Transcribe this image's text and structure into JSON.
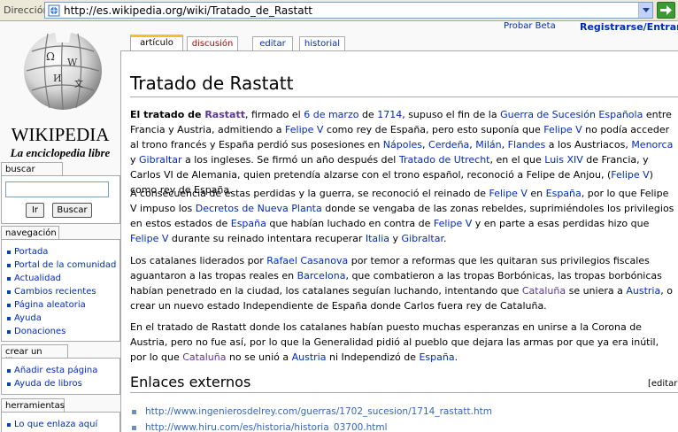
{
  "browser": {
    "address_label": "Dirección",
    "url": "http://es.wikipedia.org/wiki/Tratado_de_Rastatt"
  },
  "logo": {
    "wordmark": "WIKIPEDIA",
    "tagline": "La enciclopedia libre"
  },
  "sidebar": {
    "search": {
      "heading": "buscar",
      "go_label": "Ir",
      "search_label": "Buscar"
    },
    "navigation": {
      "heading": "navegación",
      "items": [
        "Portada",
        "Portal de la comunidad",
        "Actualidad",
        "Cambios recientes",
        "Página aleatoria",
        "Ayuda",
        "Donaciones"
      ]
    },
    "create_book": {
      "heading": "crear un libro",
      "items": [
        "Añadir esta página",
        "Ayuda de libros"
      ]
    },
    "tools": {
      "heading": "herramientas",
      "items": [
        "Lo que enlaza aquí"
      ]
    }
  },
  "top_links": {
    "beta": "Probar Beta",
    "login": "Registrarse/Entrar"
  },
  "tabs": {
    "article": "artículo",
    "discussion": "discusión",
    "edit": "editar",
    "history": "historial"
  },
  "article": {
    "title": "Tratado de Rastatt",
    "section_title": "Enlaces externos",
    "section_edit": "[editar]",
    "external_links": [
      "http://www.ingenierosdelrey.com/guerras/1702_sucesion/1714_rastatt.htm",
      "http://www.hiru.com/es/historia/historia_03700.html"
    ],
    "p1": {
      "b1": "El tratado de ",
      "b2": "Rastatt",
      "t1": ", firmado el ",
      "l1": "6 de marzo",
      "t2": " de ",
      "l2": "1714",
      "t3": ", supuso el fin de la ",
      "l3": "Guerra de Sucesión Española",
      "t4": " entre Francia y Austria, admitiendo a ",
      "l4": "Felipe V",
      "t5": " como rey de España, pero esto suponía que ",
      "l5": "Felipe V",
      "t6": " no podía acceder al trono francés y España perdió sus posesiones en ",
      "l6": "Nápoles",
      "t7": ", ",
      "l7": "Cerdeña",
      "t8": ", ",
      "l8": "Milán",
      "t9": ", ",
      "l9": "Flandes",
      "t10": " a los Austriacos, ",
      "l10": "Menorca",
      "t11": " y ",
      "l11": "Gibraltar",
      "t12": " a los ingleses. Se firmó un año después del ",
      "l12": "Tratado de Utrecht",
      "t13": ", en el que ",
      "l13": "Luis XIV",
      "t14": " de Francia, y Carlos VI de Alemania, quien pretendía alzarse con el trono español, reconoció a Felipe de Anjou, (",
      "l14": "Felipe V",
      "t15": ") como rey de España."
    },
    "p2": {
      "t1": "A consecuencia de estas perdidas y la guerra, se reconoció el reinado de ",
      "l1": "Felipe V",
      "t2": " en ",
      "l2": "España",
      "t3": ", por lo que Felipe V impuso los ",
      "l3": "Decretos de Nueva Planta",
      "t4": " donde se vengaba de las zonas rebeldes, suprimiéndoles los privilegios en estos estados de ",
      "l4": "España",
      "t5": " que habían luchado en contra de ",
      "l5": "Felipe V",
      "t6": " y en parte a esas perdidas hizo que ",
      "l6": "Felipe V",
      "t7": " durante su reinado intentara recuperar ",
      "l7": "Italia",
      "t8": " y ",
      "l8": "Gibraltar",
      "t9": "."
    },
    "p3": {
      "t1": "Los catalanes liderados por ",
      "l1": "Rafael Casanova",
      "t2": " por temor a reformas que les quitaran sus privilegios fiscales aguantaron a las tropas reales en ",
      "l2": "Barcelona",
      "t3": ", que combatieron a las tropas Borbónicas, las tropas borbónicas habían penetrado en la ciudad, los catalanes seguían luchando, intentando que ",
      "l3": "Cataluña",
      "t4": " se uniera a ",
      "l4": "Austria",
      "t5": ", o crear un nuevo estado Independiente de España donde Carlos fuera rey de Cataluña."
    },
    "p4": {
      "t1": "En el tratado de Rastatt donde los catalanes habían puesto muchas esperanzas en unirse a la Corona de Austria, pero no fue así, por lo que la Generalidad pidió al pueblo que dejara las armas por que ya era inútil, por lo que ",
      "l1": "Cataluña",
      "t2": " no se unió a ",
      "l2": "Austria",
      "t3": " ni Independizó de ",
      "l3": "España",
      "t4": "."
    }
  }
}
